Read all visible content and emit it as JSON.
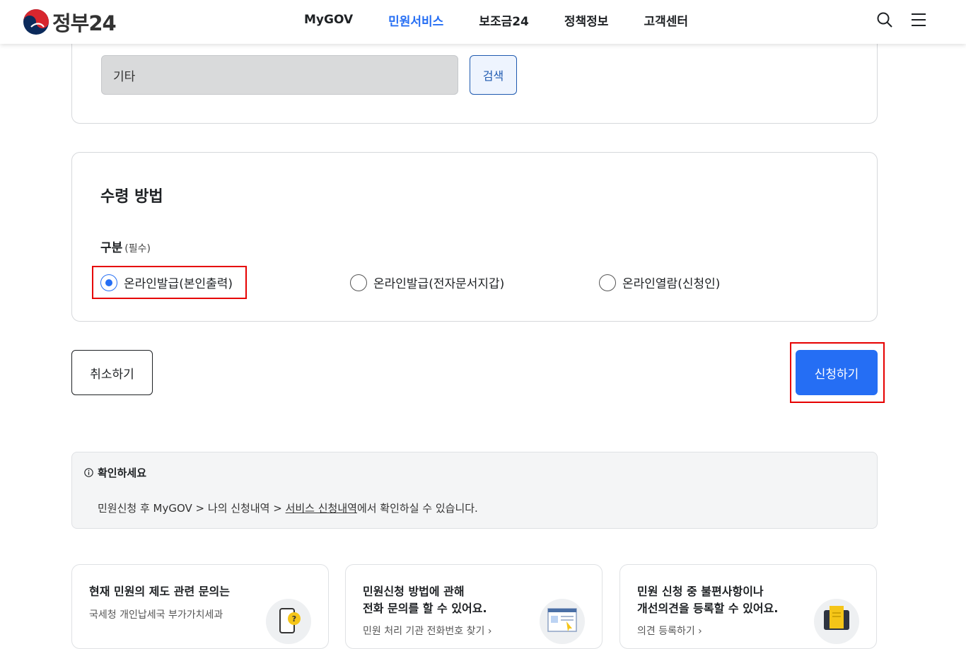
{
  "header": {
    "logo_text": "정부24",
    "nav": [
      "MyGOV",
      "민원서비스",
      "보조금24",
      "정책정보",
      "고객센터"
    ],
    "active_nav": 1
  },
  "search": {
    "value": "기타",
    "button_label": "검색"
  },
  "receipt": {
    "title": "수령 방법",
    "field_label": "구분",
    "required_text": "(필수)",
    "options": [
      "온라인발급(본인출력)",
      "온라인발급(전자문서지갑)",
      "온라인열람(신청인)"
    ],
    "selected": 0
  },
  "actions": {
    "cancel_label": "취소하기",
    "submit_label": "신청하기"
  },
  "notice": {
    "title": "확인하세요",
    "text_prefix": "민원신청 후 MyGOV > 나의 신청내역 > ",
    "text_link": "서비스 신청내역",
    "text_suffix": "에서 확인하실 수 있습니다."
  },
  "info_cards": [
    {
      "title": "현재 민원의 제도 관련 문의는",
      "sub": "국세청 개인납세국 부가가치세과",
      "link": ""
    },
    {
      "title": "민원신청 방법에 관해\n전화 문의를 할 수 있어요.",
      "sub": "",
      "link": "민원 처리 기관 전화번호 찾기"
    },
    {
      "title": "민원 신청 중 불편사항이나\n개선의견을 등록할 수 있어요.",
      "sub": "",
      "link": "의견 등록하기"
    }
  ],
  "colors": {
    "accent": "#256ef4",
    "highlight": "#e60000"
  }
}
